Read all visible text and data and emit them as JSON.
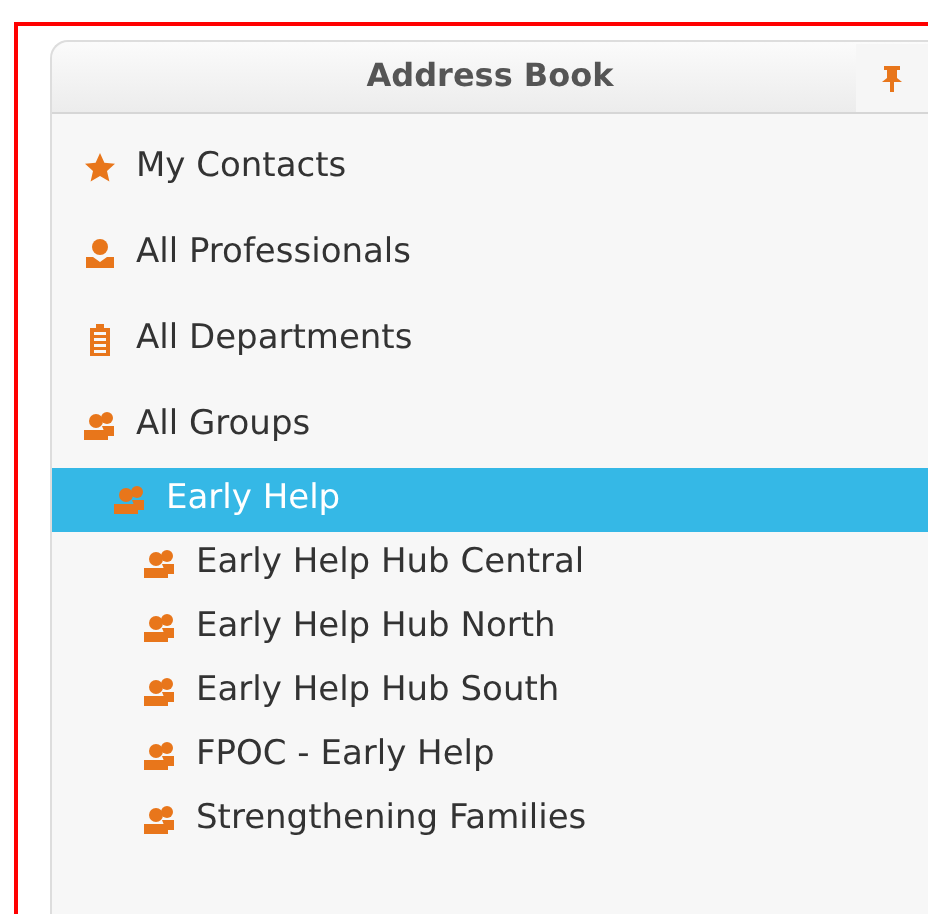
{
  "panel": {
    "title": "Address Book",
    "pinned": true
  },
  "items": [
    {
      "label": "My Contacts",
      "kind": "star",
      "selected": false
    },
    {
      "label": "All Professionals",
      "kind": "person",
      "selected": false
    },
    {
      "label": "All Departments",
      "kind": "building",
      "selected": false
    },
    {
      "label": "All Groups",
      "kind": "group",
      "selected": false,
      "children": [
        {
          "label": "Early Help",
          "kind": "group",
          "selected": true,
          "children": [
            {
              "label": "Early Help Hub Central",
              "kind": "group",
              "selected": false
            },
            {
              "label": "Early Help Hub North",
              "kind": "group",
              "selected": false
            },
            {
              "label": "Early Help Hub South",
              "kind": "group",
              "selected": false
            },
            {
              "label": "FPOC - Early Help",
              "kind": "group",
              "selected": false
            },
            {
              "label": "Strengthening Families",
              "kind": "group",
              "selected": false
            }
          ]
        }
      ]
    }
  ]
}
